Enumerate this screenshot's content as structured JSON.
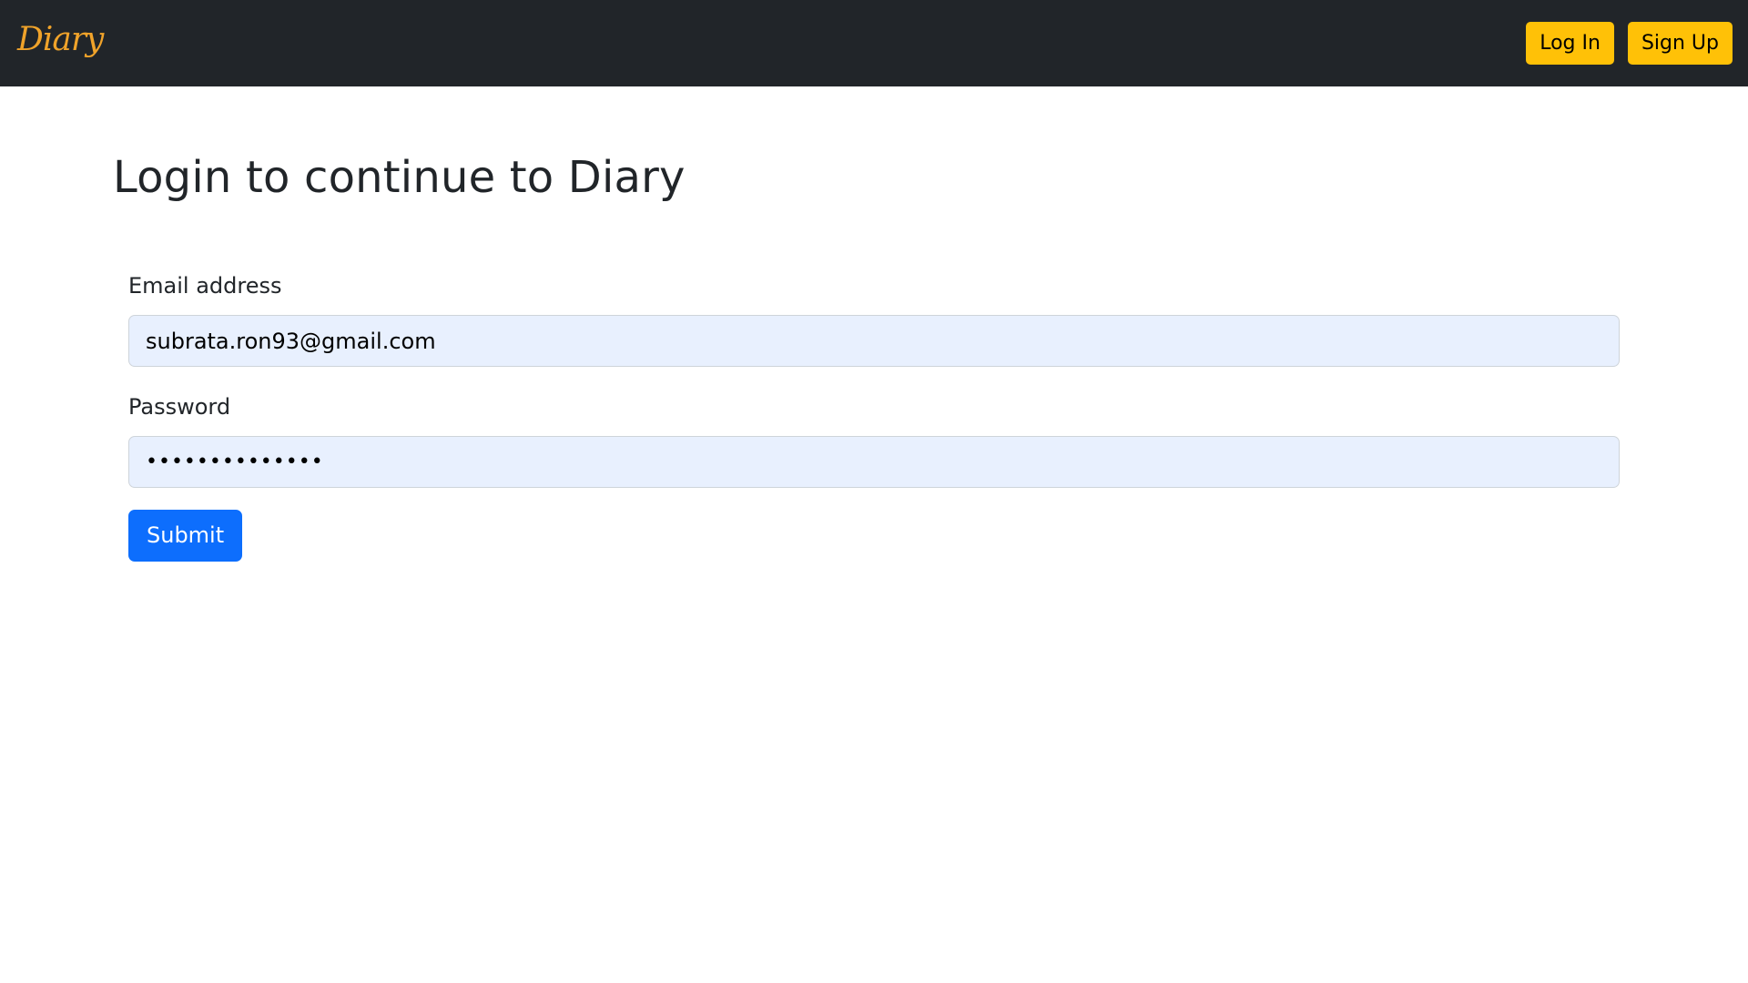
{
  "navbar": {
    "brand": "Diary",
    "login_label": "Log In",
    "signup_label": "Sign Up"
  },
  "main": {
    "title": "Login to continue to Diary",
    "form": {
      "email_label": "Email address",
      "email_value": "subrata.ron93@gmail.com",
      "password_label": "Password",
      "password_value": "subrataron1993",
      "submit_label": "Submit"
    }
  },
  "colors": {
    "navbar_bg": "#212529",
    "brand": "#f0a32a",
    "nav_button": "#ffc107",
    "primary": "#0d6efd",
    "autofill_bg": "#e8f0fe"
  }
}
